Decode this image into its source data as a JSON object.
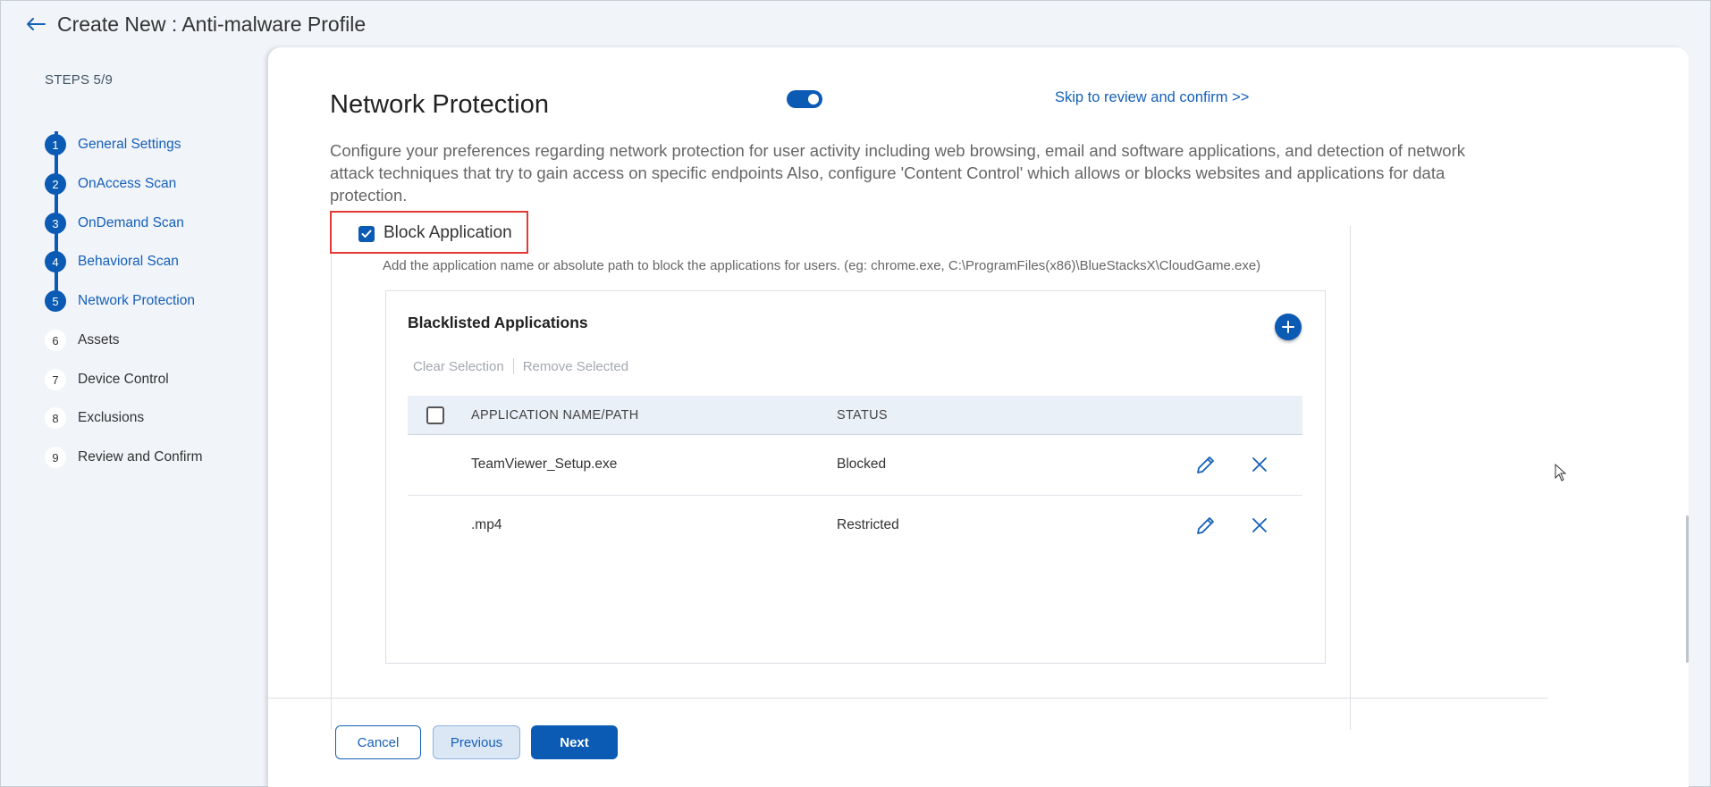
{
  "header": {
    "back_icon": "arrow-left-icon",
    "title": "Create New : Anti-malware Profile"
  },
  "sidebar": {
    "steps_label": "STEPS 5/9",
    "steps": [
      {
        "num": "1",
        "label": "General Settings",
        "state": "done"
      },
      {
        "num": "2",
        "label": "OnAccess Scan",
        "state": "done"
      },
      {
        "num": "3",
        "label": "OnDemand Scan",
        "state": "done"
      },
      {
        "num": "4",
        "label": "Behavioral Scan",
        "state": "done"
      },
      {
        "num": "5",
        "label": "Network Protection",
        "state": "current"
      },
      {
        "num": "6",
        "label": "Assets",
        "state": "todo"
      },
      {
        "num": "7",
        "label": "Device Control",
        "state": "todo"
      },
      {
        "num": "8",
        "label": "Exclusions",
        "state": "todo"
      },
      {
        "num": "9",
        "label": "Review and Confirm",
        "state": "todo"
      }
    ]
  },
  "main": {
    "section_title": "Network Protection",
    "toggle_on": true,
    "skip_link": "Skip to review and confirm >>",
    "description": "Configure your preferences regarding network protection for user activity including web browsing, email and software applications, and detection of network attack techniques that try to gain access on specific endpoints Also, configure 'Content Control' which allows or blocks websites and applications for data protection.",
    "block_application": {
      "label": "Block Application",
      "checked": true
    },
    "helper_text": "Add the application name or absolute path to block the applications for users. (eg: chrome.exe, C:\\ProgramFiles(x86)\\BlueStacksX\\CloudGame.exe)",
    "card": {
      "title": "Blacklisted Applications",
      "add_icon": "plus-icon",
      "clear_selection": "Clear Selection",
      "remove_selected": "Remove Selected",
      "columns": {
        "name": "APPLICATION NAME/PATH",
        "status": "STATUS"
      },
      "rows": [
        {
          "name": "TeamViewer_Setup.exe",
          "status": "Blocked"
        },
        {
          "name": ".mp4",
          "status": "Restricted"
        }
      ]
    }
  },
  "footer": {
    "cancel": "Cancel",
    "previous": "Previous",
    "next": "Next"
  },
  "colors": {
    "accent": "#0b5ab4",
    "link": "#1560b8",
    "highlight_border": "#e53935"
  }
}
